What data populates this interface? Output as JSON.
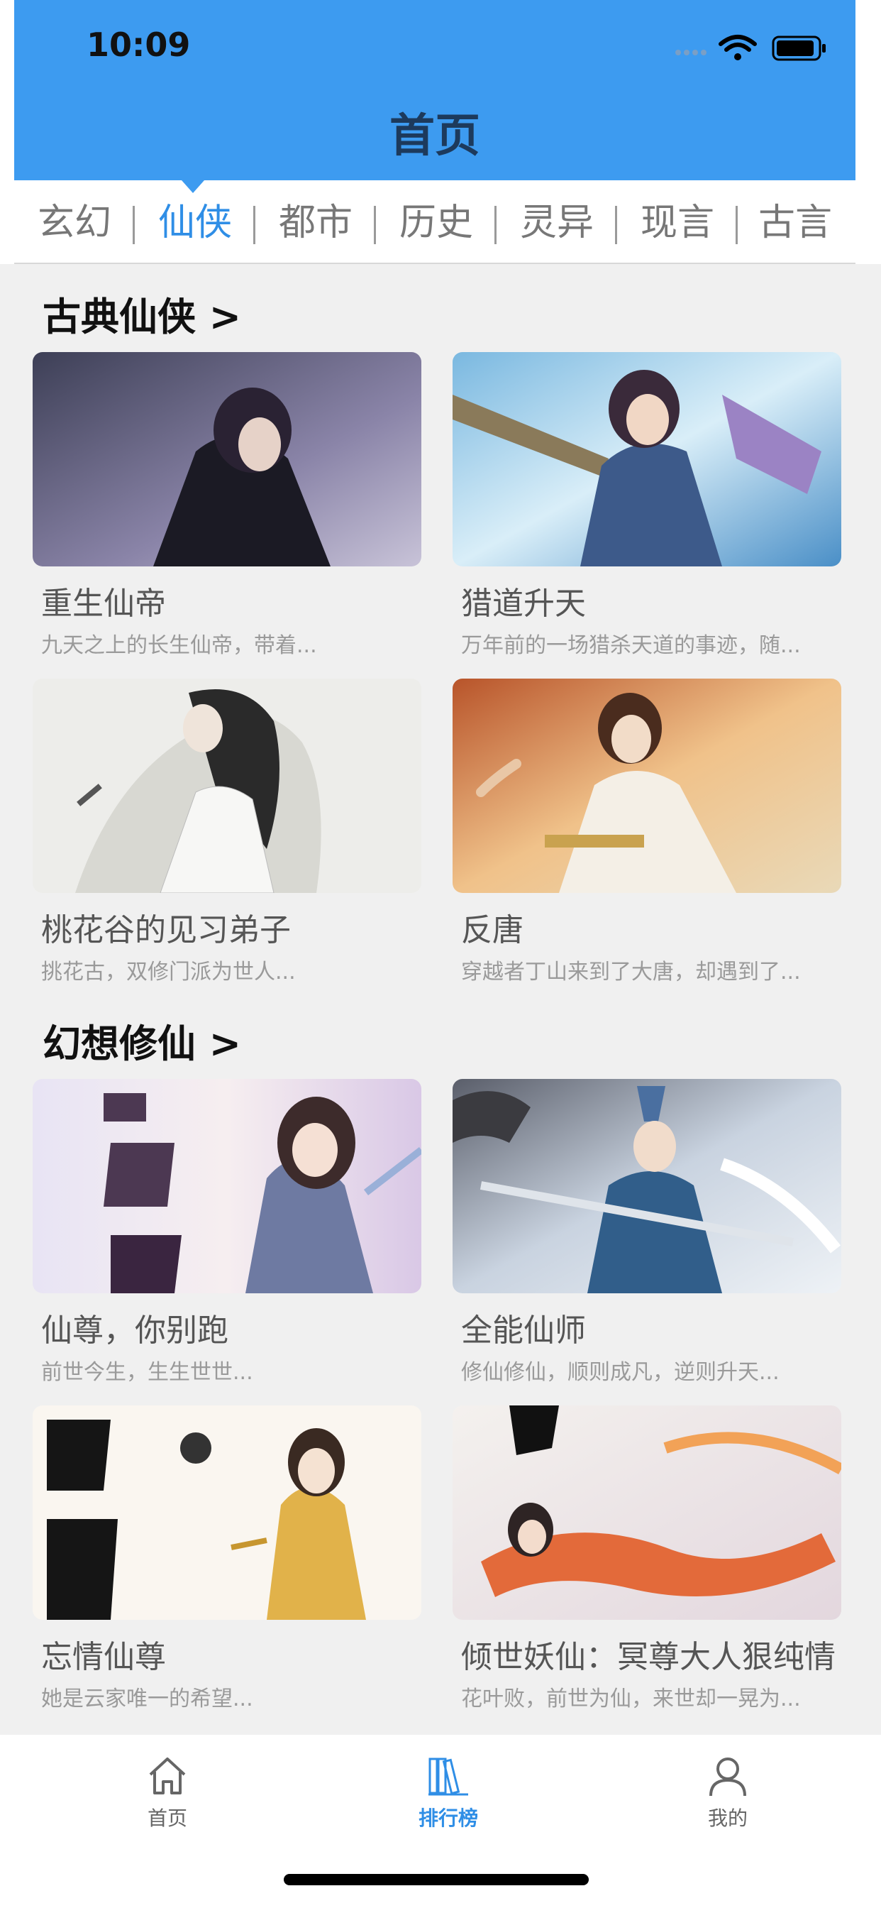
{
  "status_bar": {
    "time": "10:09"
  },
  "header": {
    "title": "首页"
  },
  "tabs": [
    {
      "label": "玄幻"
    },
    {
      "label": "仙侠"
    },
    {
      "label": "都市"
    },
    {
      "label": "历史"
    },
    {
      "label": "灵异"
    },
    {
      "label": "现言"
    },
    {
      "label": "古言"
    }
  ],
  "active_tab": "仙侠",
  "sections": [
    {
      "title": "古典仙侠 >",
      "books": [
        {
          "title": "重生仙帝",
          "desc": "九天之上的长生仙帝，带着..."
        },
        {
          "title": "猎道升天",
          "desc": "万年前的一场猎杀天道的事迹，随..."
        },
        {
          "title": "桃花谷的见习弟子",
          "desc": "挑花古，双修门派为世人..."
        },
        {
          "title": "反唐",
          "desc": "穿越者丁山来到了大唐，却遇到了..."
        }
      ]
    },
    {
      "title": "幻想修仙 >",
      "books": [
        {
          "title": "仙尊，你别跑",
          "desc": "前世今生，生生世世..."
        },
        {
          "title": "全能仙师",
          "desc": "修仙修仙，顺则成凡，逆则升天..."
        },
        {
          "title": "忘情仙尊",
          "desc": "她是云家唯一的希望..."
        },
        {
          "title": "倾世妖仙：冥尊大人狠纯情",
          "desc": "花叶败，前世为仙，来世却一晃为..."
        }
      ]
    }
  ],
  "tabbar": [
    {
      "label": "首页",
      "icon": "home-icon"
    },
    {
      "label": "排行榜",
      "icon": "books-icon"
    },
    {
      "label": "我的",
      "icon": "user-icon"
    }
  ],
  "colors": {
    "accent": "#3d9bf0",
    "active_text": "#2f8ee6"
  }
}
